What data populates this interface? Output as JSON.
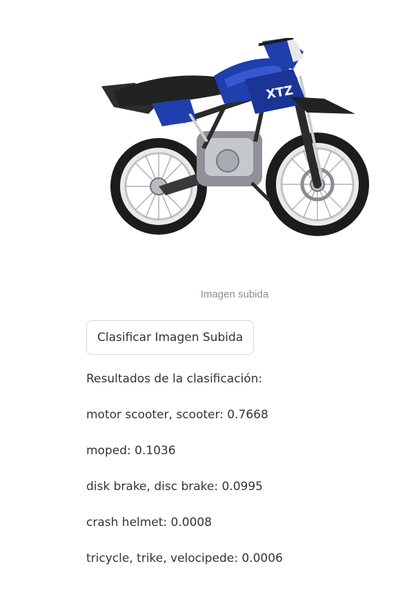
{
  "image": {
    "caption": "Imagen subida",
    "brand_text": "XTZ",
    "colors": {
      "body_blue": "#1f3fae",
      "seat_black": "#222222",
      "chrome": "#bfc2c7"
    }
  },
  "actions": {
    "classify_label": "Clasificar Imagen Subida"
  },
  "results": {
    "title": "Resultados de la clasificación:",
    "items": [
      "motor scooter, scooter: 0.7668",
      "moped: 0.1036",
      "disk brake, disc brake: 0.0995",
      "crash helmet: 0.0008",
      "tricycle, trike, velocipede: 0.0006"
    ]
  }
}
